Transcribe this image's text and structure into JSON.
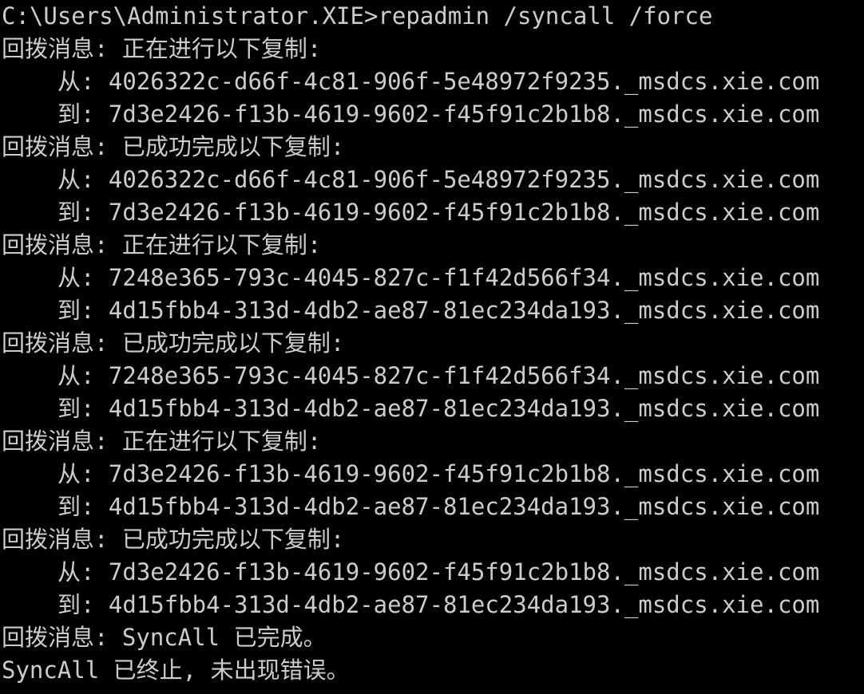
{
  "terminal": {
    "command_line": "C:\\Users\\Administrator.XIE>repadmin /syncall /force",
    "lines": [
      {
        "text": "回拨消息: 正在进行以下复制:",
        "indent": false
      },
      {
        "text": "从: 4026322c-d66f-4c81-906f-5e48972f9235._msdcs.xie.com",
        "indent": true
      },
      {
        "text": "到: 7d3e2426-f13b-4619-9602-f45f91c2b1b8._msdcs.xie.com",
        "indent": true
      },
      {
        "text": "回拨消息: 已成功完成以下复制:",
        "indent": false
      },
      {
        "text": "从: 4026322c-d66f-4c81-906f-5e48972f9235._msdcs.xie.com",
        "indent": true
      },
      {
        "text": "到: 7d3e2426-f13b-4619-9602-f45f91c2b1b8._msdcs.xie.com",
        "indent": true
      },
      {
        "text": "回拨消息: 正在进行以下复制:",
        "indent": false
      },
      {
        "text": "从: 7248e365-793c-4045-827c-f1f42d566f34._msdcs.xie.com",
        "indent": true
      },
      {
        "text": "到: 4d15fbb4-313d-4db2-ae87-81ec234da193._msdcs.xie.com",
        "indent": true
      },
      {
        "text": "回拨消息: 已成功完成以下复制:",
        "indent": false
      },
      {
        "text": "从: 7248e365-793c-4045-827c-f1f42d566f34._msdcs.xie.com",
        "indent": true
      },
      {
        "text": "到: 4d15fbb4-313d-4db2-ae87-81ec234da193._msdcs.xie.com",
        "indent": true
      },
      {
        "text": "回拨消息: 正在进行以下复制:",
        "indent": false
      },
      {
        "text": "从: 7d3e2426-f13b-4619-9602-f45f91c2b1b8._msdcs.xie.com",
        "indent": true
      },
      {
        "text": "到: 4d15fbb4-313d-4db2-ae87-81ec234da193._msdcs.xie.com",
        "indent": true
      },
      {
        "text": "回拨消息: 已成功完成以下复制:",
        "indent": false
      },
      {
        "text": "从: 7d3e2426-f13b-4619-9602-f45f91c2b1b8._msdcs.xie.com",
        "indent": true
      },
      {
        "text": "到: 4d15fbb4-313d-4db2-ae87-81ec234da193._msdcs.xie.com",
        "indent": true
      },
      {
        "text": "回拨消息: SyncAll 已完成。",
        "indent": false
      },
      {
        "text": "SyncAll 已终止, 未出现错误。",
        "indent": false
      }
    ],
    "colors": {
      "background": "#000000",
      "foreground": "#cccccc"
    }
  }
}
